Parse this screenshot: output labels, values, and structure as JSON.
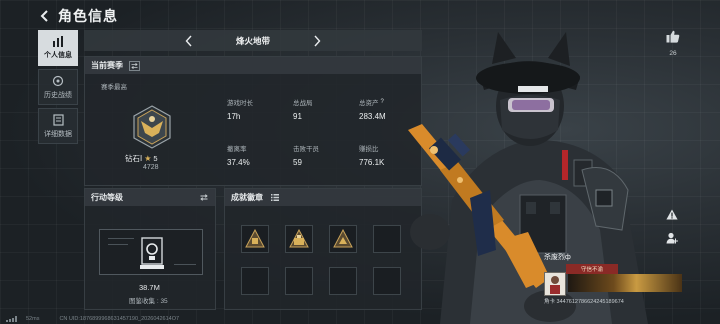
{
  "header": {
    "title": "角色信息"
  },
  "nav": {
    "items": [
      {
        "label": "个人信息",
        "icon": "bar-chart-icon",
        "active": true
      },
      {
        "label": "历史战绩",
        "icon": "clock-target-icon",
        "active": false
      },
      {
        "label": "详细数据",
        "icon": "document-icon",
        "active": false
      }
    ]
  },
  "map_bar": {
    "map_name": "烽火地带"
  },
  "season": {
    "title": "当前赛季",
    "subtitle": "赛季最高",
    "rank_name": "钻石Ⅰ",
    "rank_stars": "5",
    "rank_score": "4728"
  },
  "stats": [
    {
      "label": "游戏时长",
      "value": "17h"
    },
    {
      "label": "总战局",
      "value": "91"
    },
    {
      "label": "总资产",
      "value": "283.4M",
      "help": "?"
    },
    {
      "label": "撤离率",
      "value": "37.4%"
    },
    {
      "label": "击败干员",
      "value": "59"
    },
    {
      "label": "赚损比",
      "value": "776.1K"
    }
  ],
  "action_level": {
    "title": "行动等级",
    "value": "38.7M",
    "collection_label": "图鉴收集",
    "collection_value": "35"
  },
  "achievements": {
    "title": "成就徽章"
  },
  "right_ui": {
    "like_count": "26"
  },
  "player_card": {
    "name": "杀废烈ф",
    "guard_label": "守信不渝",
    "id_line": "角卡 3447612786624245189674"
  },
  "footer": {
    "ping": "52ms",
    "uid_line": "CN UID:1876899968631457190_2026042614O7"
  },
  "colors": {
    "accent_light": "#d7dcdf",
    "gold": "#d9b15a",
    "weapon_orange": "#d98b2b",
    "guard_red": "#8a2a26"
  }
}
